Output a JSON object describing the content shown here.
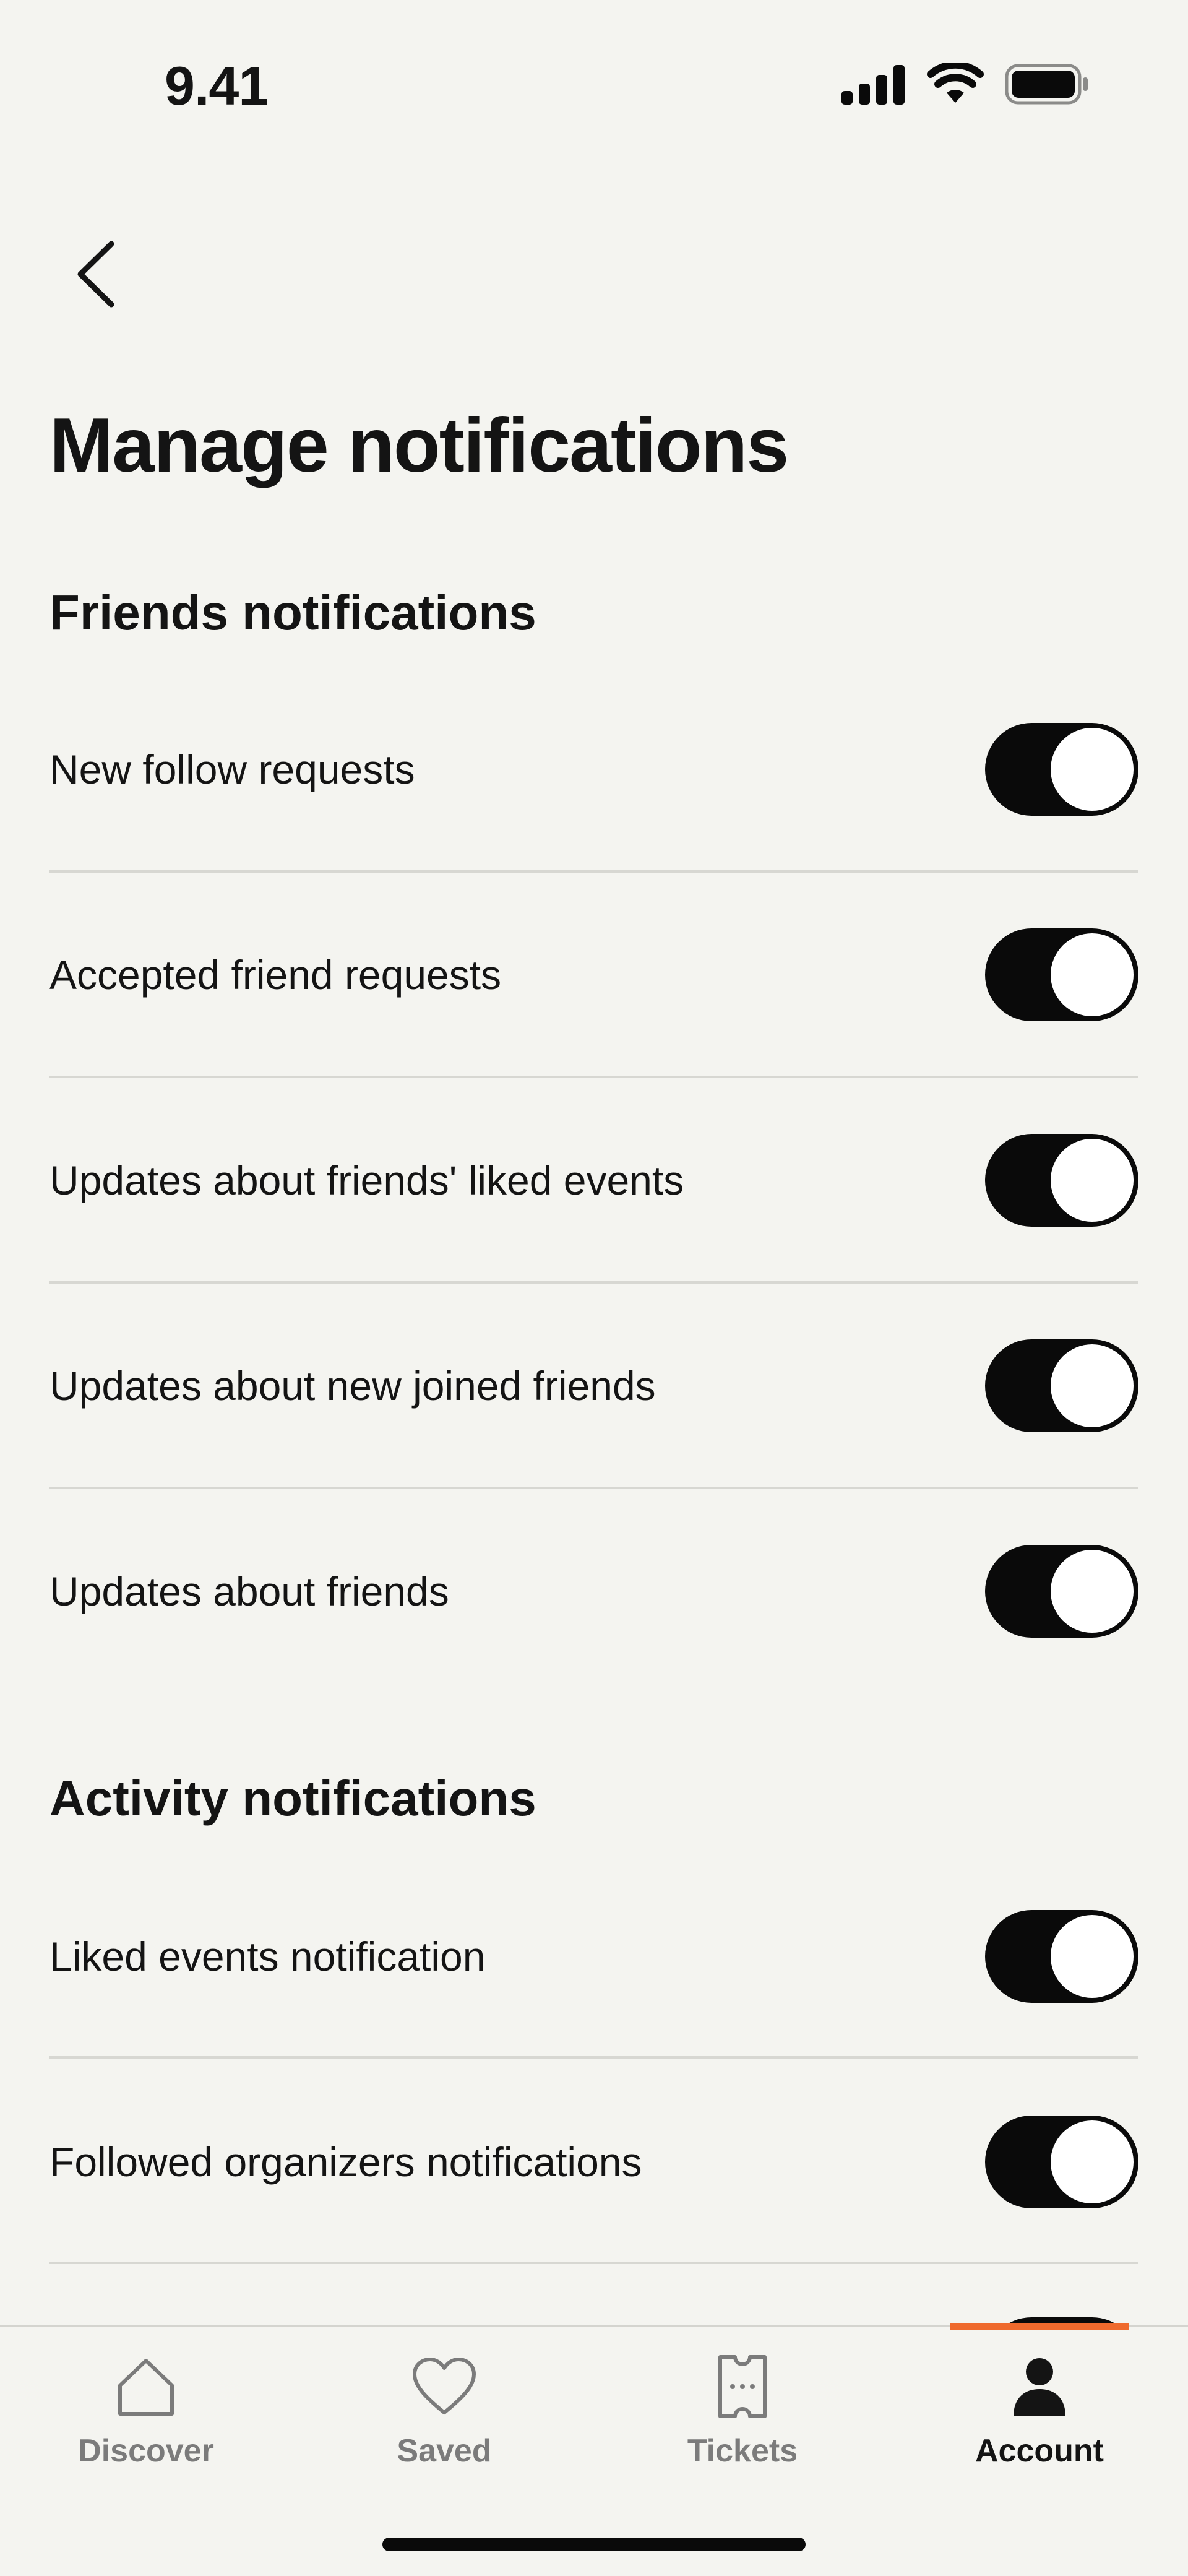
{
  "status_bar": {
    "time": "9.41"
  },
  "header": {
    "back_icon": "chevron-left-icon",
    "title": "Manage notifications"
  },
  "sections": {
    "friends": {
      "heading": "Friends notifications",
      "items": [
        {
          "label": "New follow requests",
          "enabled": true
        },
        {
          "label": "Accepted friend requests",
          "enabled": true
        },
        {
          "label": "Updates about friends' liked events",
          "enabled": true
        },
        {
          "label": "Updates about new joined friends",
          "enabled": true
        },
        {
          "label": "Updates about friends",
          "enabled": true
        }
      ]
    },
    "activity": {
      "heading": "Activity notifications",
      "items": [
        {
          "label": "Liked events notification",
          "enabled": true
        },
        {
          "label": "Followed organizers notifications",
          "enabled": true
        }
      ]
    }
  },
  "tab_bar": {
    "active": "account",
    "tabs": [
      {
        "id": "discover",
        "label": "Discover",
        "icon": "home-icon"
      },
      {
        "id": "saved",
        "label": "Saved",
        "icon": "heart-icon"
      },
      {
        "id": "tickets",
        "label": "Tickets",
        "icon": "ticket-icon"
      },
      {
        "id": "account",
        "label": "Account",
        "icon": "person-icon"
      }
    ]
  },
  "colors": {
    "background": "#f4f4f0",
    "toggle_on": "#0a0a0a",
    "accent": "#ef6a2d",
    "divider": "#d7d7d2",
    "tab_inactive": "#7b7b7b"
  }
}
